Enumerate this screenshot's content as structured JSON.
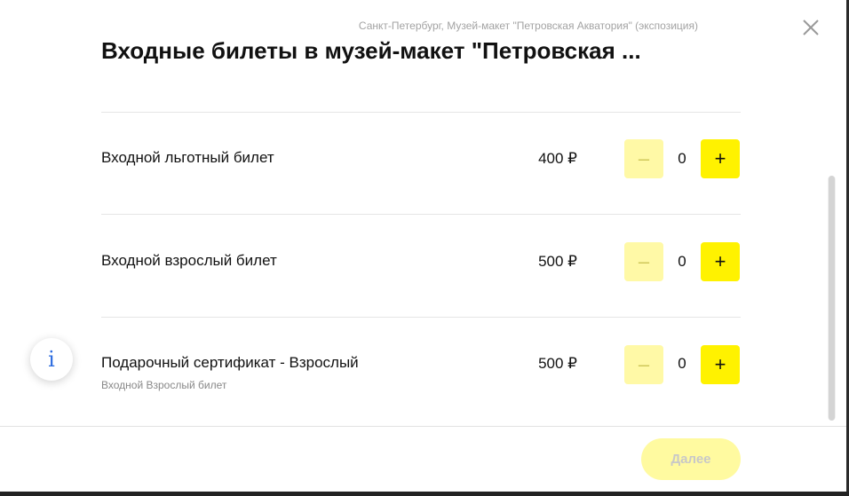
{
  "header": {
    "subtitle": "Санкт-Петербург, Музей-макет \"Петровская Акватория\" (экспозиция)",
    "title": "Входные билеты в музей-макет \"Петровская ...",
    "close_icon": "close-icon"
  },
  "tickets": [
    {
      "name": "Входной льготный билет",
      "description": "",
      "price": "400 ₽",
      "quantity": "0",
      "minus_label": "–",
      "plus_label": "+"
    },
    {
      "name": "Входной взрослый билет",
      "description": "",
      "price": "500 ₽",
      "quantity": "0",
      "minus_label": "–",
      "plus_label": "+"
    },
    {
      "name": "Подарочный сертификат - Взрослый",
      "description": "Входной Взрослый билет",
      "price": "500 ₽",
      "quantity": "0",
      "minus_label": "–",
      "plus_label": "+"
    }
  ],
  "info_button": {
    "label": "i",
    "icon": "info-icon"
  },
  "footer": {
    "next_label": "Далее"
  },
  "colors": {
    "accent": "#fff200",
    "accent_disabled": "#fff9a6",
    "info": "#2d6cdf"
  }
}
